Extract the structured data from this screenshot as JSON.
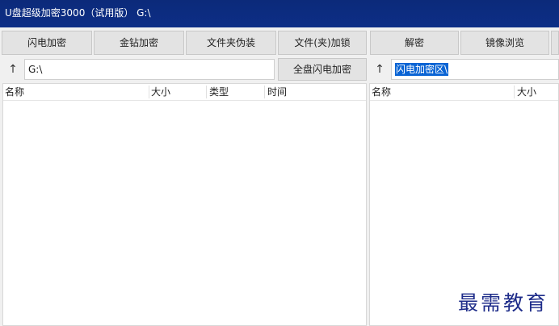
{
  "window": {
    "title": "U盘超级加密3000（试用版） G:\\"
  },
  "toolbar": {
    "buttons": [
      "闪电加密",
      "金钻加密",
      "文件夹伪装",
      "文件(夹)加锁",
      "解密",
      "镜像浏览"
    ]
  },
  "left": {
    "up_label": "↑",
    "path": "G:\\",
    "full_disk_button": "全盘闪电加密",
    "columns": [
      "名称",
      "大小",
      "类型",
      "时间"
    ]
  },
  "right": {
    "up_label": "↑",
    "path": "闪电加密区\\",
    "columns": [
      "名称",
      "大小"
    ]
  },
  "watermark": "最需教育"
}
